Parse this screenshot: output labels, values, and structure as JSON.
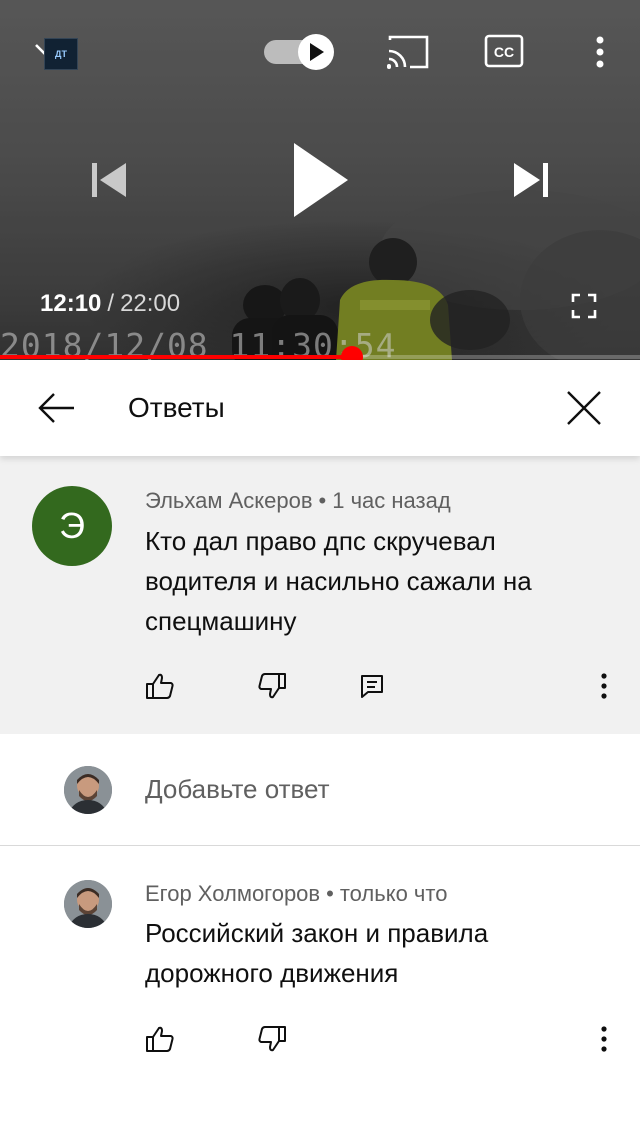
{
  "player": {
    "current_time": "12:10",
    "separator": "/",
    "total_time": "22:00",
    "burned_timestamp": "2018/12/08 11:30:54",
    "progress_fraction": 0.55,
    "icons": {
      "minimize": "chevron-down-icon",
      "channel_logo": "channel-logo",
      "autoplay": "autoplay-toggle-icon",
      "cast": "cast-icon",
      "captions": "cc-icon",
      "more": "more-vert-icon",
      "previous": "skip-previous-icon",
      "play": "play-icon",
      "next": "skip-next-icon",
      "fullscreen": "fullscreen-icon"
    },
    "captions_label": "CC",
    "accent_color": "#ff0000"
  },
  "replies": {
    "title": "Ответы",
    "back_icon": "arrow-back-icon",
    "close_icon": "close-icon"
  },
  "parent_comment": {
    "avatar_letter": "Э",
    "avatar_color": "#33691e",
    "author": "Эльхам Аскеров",
    "dot": "•",
    "time": "1 час назад",
    "text_lines": [
      "Кто дал право дпс скручевал",
      "водителя и насильно сажали на",
      "спецмашину"
    ],
    "actions": [
      "thumb-up-icon",
      "thumb-down-icon",
      "reply-icon",
      "more-vert-icon"
    ]
  },
  "add_reply": {
    "placeholder": "Добавьте ответ"
  },
  "reply_comment": {
    "author": "Егор Холмогоров",
    "dot": "•",
    "time": "только что",
    "text_lines": [
      "Российский закон и правила",
      "дорожного движения"
    ],
    "actions": [
      "thumb-up-icon",
      "thumb-down-icon",
      "more-vert-icon"
    ]
  }
}
